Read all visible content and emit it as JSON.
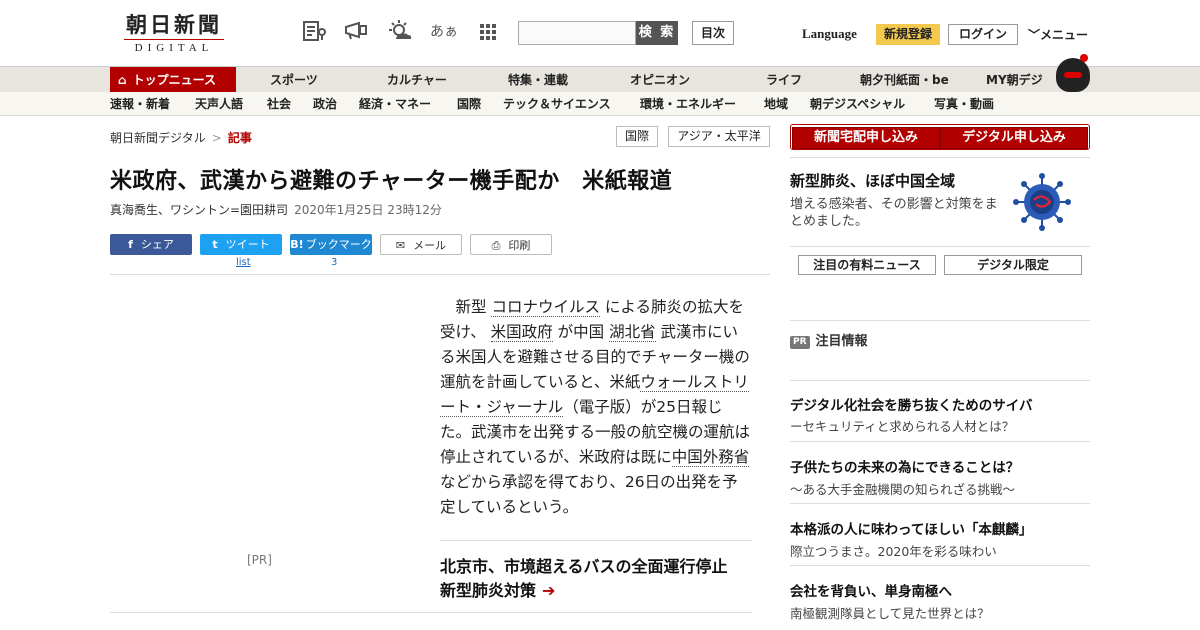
{
  "header": {
    "logo_main": "朝日新聞",
    "logo_sub": "DIGITAL",
    "search_button": "検 索",
    "toc_button": "目次",
    "language": "Language",
    "register": "新規登録",
    "login": "ログイン",
    "menu": "メニュー",
    "icons": [
      "newspaper-icon",
      "megaphone-icon",
      "weather-icon",
      "font-size-icon",
      "apps-grid-icon"
    ],
    "font_icon_text": "あぁ"
  },
  "nav_primary": [
    "トップニュース",
    "スポーツ",
    "カルチャー",
    "特集・連載",
    "オピニオン",
    "ライフ",
    "朝夕刊紙面・be",
    "MY朝デジ"
  ],
  "nav_secondary": [
    "速報・新着",
    "天声人語",
    "社会",
    "政治",
    "経済・マネー",
    "国際",
    "テック＆サイエンス",
    "環境・エネルギー",
    "地域",
    "朝デジスペシャル",
    "写真・動画"
  ],
  "breadcrumb": {
    "home": "朝日新聞デジタル",
    "separator": ">",
    "current": "記事",
    "tags": [
      "国際",
      "アジア・太平洋"
    ]
  },
  "article": {
    "title": "米政府、武漢から避難のチャーター機手配か　米紙報道",
    "author": "真海喬生、ワシントン=園田耕司",
    "date": "2020年1月25日 23時12分",
    "share": {
      "facebook": "シェア",
      "twitter": "ツイート",
      "hatena": "ブックマーク",
      "mail": "メール",
      "print": "印刷",
      "twitter_count": "list",
      "hatena_count": "3"
    },
    "body": {
      "p1": "新型",
      "k1": "コロナウイルス",
      "p2": "による肺炎の拡大を受け、",
      "k2": "米国政府",
      "p3": "が中国",
      "k3": "湖北省",
      "p4": "武漢市にいる米国人を避難させる目的でチャーター機の運航を計画していると、米紙",
      "k4": "ウォールストリート・ジャーナル",
      "p5": "（電子版）が25日報じた。武漢市を出発する一般の航空機の運航は停止されているが、米政府は既に",
      "k5": "中国外務省",
      "p6": "などから承認を得ており、26日の出発を予定しているという。"
    },
    "pr_label": "[PR]",
    "related": "北京市、市境超えるバスの全面運行停止　新型肺炎対策",
    "related_arrow": "➔"
  },
  "sidebar": {
    "btn_delivery": "新聞宅配申し込み",
    "btn_digital": "デジタル申し込み",
    "feature_title": "新型肺炎、ほぼ中国全域",
    "feature_desc": "増える感染者、その影響と対策をまとめました。",
    "tab_paid": "注目の有料ニュース",
    "tab_digital": "デジタル限定",
    "pr_badge": "PR",
    "pr_heading": "注目情報",
    "ads": [
      {
        "title": "デジタル化社会を勝ち抜くためのサイバ",
        "sub": "ーセキュリティと求められる人材とは？"
      },
      {
        "title": "子供たちの未来の為にできることは？",
        "sub": "～ある大手金融機関の知られざる挑戦～"
      },
      {
        "title": "本格派の人に味わってほしい「本麒麟」",
        "sub": "際立つうまさ。2020年を彩る味わい"
      },
      {
        "title": "会社を背負い、単身南極へ",
        "sub": "南極観測隊員として見た世界とは？"
      }
    ]
  },
  "colors": {
    "brand_red": "#b20000",
    "register_yellow": "#f2c94c",
    "facebook": "#3b5998",
    "twitter": "#1da1f2",
    "hatena": "#1e88d2"
  }
}
